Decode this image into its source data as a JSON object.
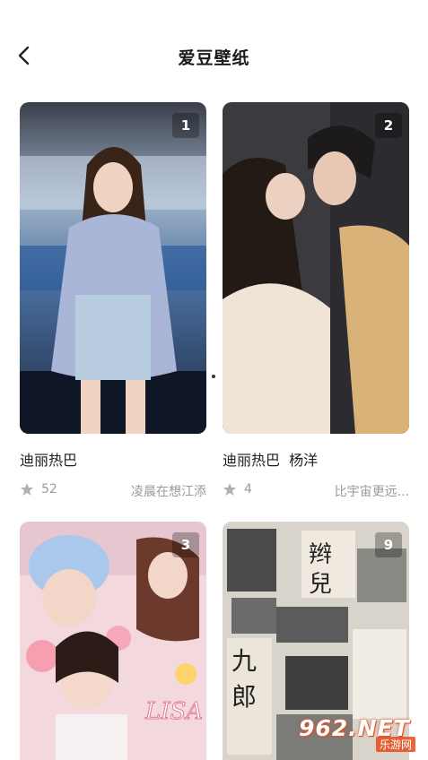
{
  "header": {
    "title": "爱豆壁纸",
    "back_icon": "back-arrow-icon"
  },
  "cards": [
    {
      "badge": "1",
      "title": "迪丽热巴",
      "likes": "52",
      "author": "凌晨在想江添"
    },
    {
      "badge": "2",
      "title": "迪丽热巴  杨洋",
      "likes": "4",
      "author": "比宇宙更远..."
    },
    {
      "badge": "3",
      "title": "",
      "likes": "",
      "author": ""
    },
    {
      "badge": "9",
      "title": "",
      "likes": "",
      "author": ""
    }
  ],
  "wallpaper_texts": {
    "card3_caption": "LISA",
    "card4_word1": "辫",
    "card4_word2": "兒",
    "card4_word3": "九",
    "card4_word4": "郎"
  },
  "watermark": {
    "main": "962.NET",
    "sub": "乐游网"
  },
  "colors": {
    "accent": "#e64a19",
    "star": "#b0b0b0"
  }
}
